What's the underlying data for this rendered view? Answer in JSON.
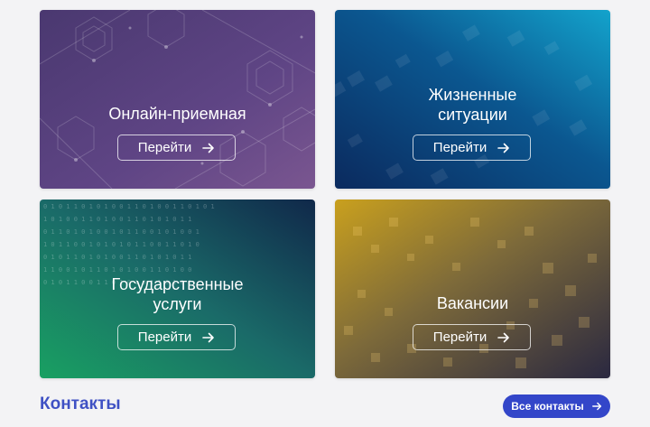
{
  "cards": [
    {
      "title": "Онлайн-приемная",
      "button": "Перейти",
      "icon": "arrow-right-icon"
    },
    {
      "title_line1": "Жизненные",
      "title_line2": "ситуации",
      "button": "Перейти",
      "icon": "arrow-right-icon"
    },
    {
      "title_line1": "Государственные",
      "title_line2": "услуги",
      "button": "Перейти",
      "icon": "arrow-right-icon"
    },
    {
      "title": "Вакансии",
      "button": "Перейти",
      "icon": "arrow-right-icon"
    }
  ],
  "contacts": {
    "title": "Контакты",
    "button": "Все контакты",
    "icon": "arrow-right-icon"
  },
  "colors": {
    "accent": "#3346c9",
    "heading": "#3f51c4",
    "card_purple": "#5e4380",
    "card_blue": "#0a4d86",
    "card_green": "#1e7a5e",
    "card_gold": "#9b7a22"
  }
}
